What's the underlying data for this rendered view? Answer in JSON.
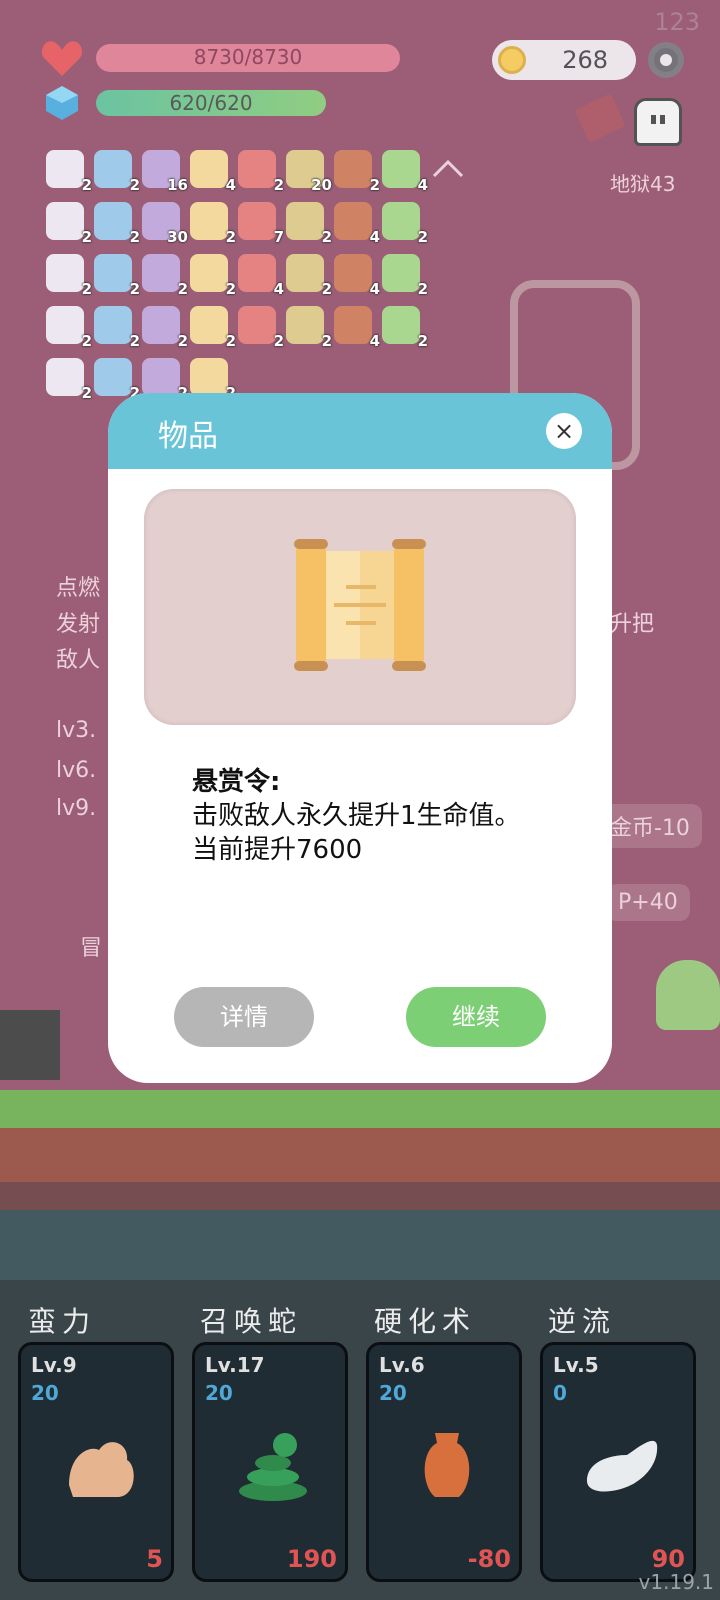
{
  "hud": {
    "hp": "8730/8730",
    "mp": "620/620",
    "coins": "268",
    "stage": "地狱43",
    "fps": "123"
  },
  "inventory": {
    "counts": [
      "2",
      "2",
      "16",
      "4",
      "2",
      "20",
      "2",
      "4",
      "2",
      "2",
      "30",
      "2",
      "7",
      "2",
      "4",
      "2",
      "2",
      "2",
      "2",
      "2",
      "4",
      "2",
      "4",
      "2",
      "2",
      "2",
      "2",
      "2",
      "2",
      "2",
      "4",
      "2",
      "2",
      "2",
      "2",
      "2"
    ]
  },
  "background": {
    "lines": [
      "点燃",
      "发射",
      "敌人",
      "lv3.",
      "lv6.",
      "lv9.",
      "升把",
      "金币-10",
      "P+40",
      "冒",
      "lv"
    ]
  },
  "modal": {
    "title": "物品",
    "close": "×",
    "item_name": "悬赏令:",
    "item_desc": "击败敌人永久提升1生命值。",
    "item_bonus": "当前提升7600",
    "btn_detail": "详情",
    "btn_continue": "继续"
  },
  "skills": [
    {
      "name": "蛮力",
      "lv": "Lv.9",
      "pts": "20",
      "value": "5",
      "icon": "muscle-icon"
    },
    {
      "name": "召唤蛇",
      "lv": "Lv.17",
      "pts": "20",
      "value": "190",
      "icon": "snake-icon"
    },
    {
      "name": "硬化术",
      "lv": "Lv.6",
      "pts": "20",
      "value": "-80",
      "icon": "vase-icon"
    },
    {
      "name": "逆流",
      "lv": "Lv.5",
      "pts": "0",
      "value": "90",
      "icon": "wing-icon"
    }
  ],
  "version": "v1.19.1",
  "colors": {
    "bg": "#8a3f5c",
    "hp": "#d96f88",
    "header": "#6ac4d8",
    "continue": "#7dcf75",
    "detail": "#b6b6b6"
  }
}
